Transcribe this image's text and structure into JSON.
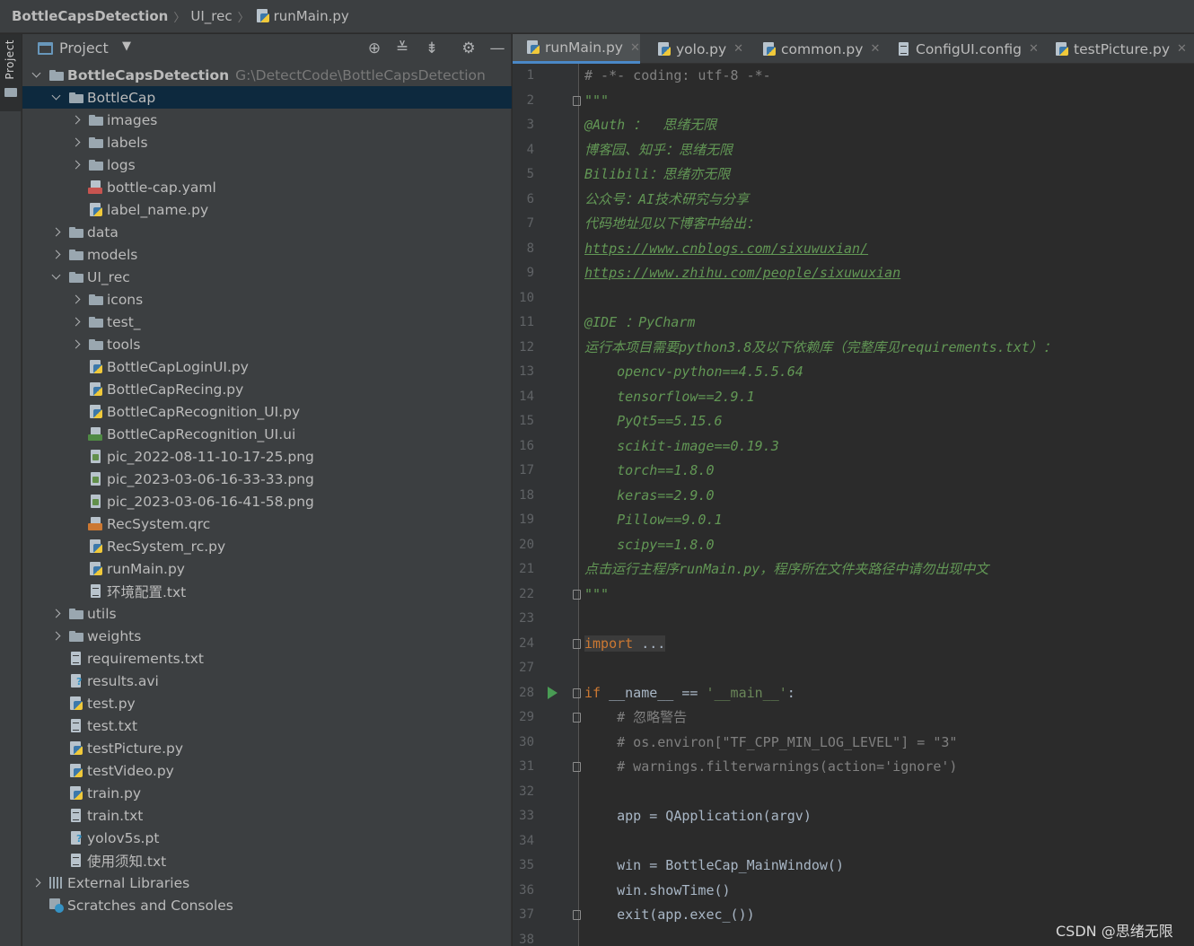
{
  "breadcrumb": [
    "BottleCapsDetection",
    "UI_rec",
    "runMain.py"
  ],
  "stripe": {
    "project_label": "Project"
  },
  "panel": {
    "title": "Project"
  },
  "tree": [
    {
      "depth": 0,
      "arrow": "down",
      "icon": "folder",
      "name": "BottleCapsDetection",
      "path": "G:\\DetectCode\\BottleCapsDetection",
      "bold": true
    },
    {
      "depth": 1,
      "arrow": "down",
      "icon": "folder",
      "name": "BottleCap",
      "selected": true
    },
    {
      "depth": 2,
      "arrow": "right",
      "icon": "folder",
      "name": "images"
    },
    {
      "depth": 2,
      "arrow": "right",
      "icon": "folder",
      "name": "labels"
    },
    {
      "depth": 2,
      "arrow": "right",
      "icon": "folder",
      "name": "logs"
    },
    {
      "depth": 2,
      "arrow": "none",
      "icon": "yamlfile",
      "name": "bottle-cap.yaml"
    },
    {
      "depth": 2,
      "arrow": "none",
      "icon": "pyfile",
      "name": "label_name.py"
    },
    {
      "depth": 1,
      "arrow": "right",
      "icon": "folder",
      "name": "data"
    },
    {
      "depth": 1,
      "arrow": "right",
      "icon": "folder",
      "name": "models"
    },
    {
      "depth": 1,
      "arrow": "down",
      "icon": "folder",
      "name": "UI_rec"
    },
    {
      "depth": 2,
      "arrow": "right",
      "icon": "folder",
      "name": "icons"
    },
    {
      "depth": 2,
      "arrow": "right",
      "icon": "folder",
      "name": "test_"
    },
    {
      "depth": 2,
      "arrow": "right",
      "icon": "folder",
      "name": "tools"
    },
    {
      "depth": 2,
      "arrow": "none",
      "icon": "pyfile",
      "name": "BottleCapLoginUI.py"
    },
    {
      "depth": 2,
      "arrow": "none",
      "icon": "pyfile",
      "name": "BottleCapRecing.py"
    },
    {
      "depth": 2,
      "arrow": "none",
      "icon": "pyfile",
      "name": "BottleCapRecognition_UI.py"
    },
    {
      "depth": 2,
      "arrow": "none",
      "icon": "uifile",
      "name": "BottleCapRecognition_UI.ui"
    },
    {
      "depth": 2,
      "arrow": "none",
      "icon": "pngfile",
      "name": "pic_2022-08-11-10-17-25.png"
    },
    {
      "depth": 2,
      "arrow": "none",
      "icon": "pngfile",
      "name": "pic_2023-03-06-16-33-33.png"
    },
    {
      "depth": 2,
      "arrow": "none",
      "icon": "pngfile",
      "name": "pic_2023-03-06-16-41-58.png"
    },
    {
      "depth": 2,
      "arrow": "none",
      "icon": "qrcfile",
      "name": "RecSystem.qrc"
    },
    {
      "depth": 2,
      "arrow": "none",
      "icon": "pyfile",
      "name": "RecSystem_rc.py"
    },
    {
      "depth": 2,
      "arrow": "none",
      "icon": "pyfile",
      "name": "runMain.py"
    },
    {
      "depth": 2,
      "arrow": "none",
      "icon": "txtfile",
      "name": "环境配置.txt"
    },
    {
      "depth": 1,
      "arrow": "right",
      "icon": "folder",
      "name": "utils"
    },
    {
      "depth": 1,
      "arrow": "right",
      "icon": "folder",
      "name": "weights"
    },
    {
      "depth": 1,
      "arrow": "none",
      "icon": "txtfile",
      "name": "requirements.txt"
    },
    {
      "depth": 1,
      "arrow": "none",
      "icon": "unknown",
      "name": "results.avi"
    },
    {
      "depth": 1,
      "arrow": "none",
      "icon": "pyfile",
      "name": "test.py"
    },
    {
      "depth": 1,
      "arrow": "none",
      "icon": "txtfile",
      "name": "test.txt"
    },
    {
      "depth": 1,
      "arrow": "none",
      "icon": "pyfile",
      "name": "testPicture.py"
    },
    {
      "depth": 1,
      "arrow": "none",
      "icon": "pyfile",
      "name": "testVideo.py"
    },
    {
      "depth": 1,
      "arrow": "none",
      "icon": "pyfile",
      "name": "train.py"
    },
    {
      "depth": 1,
      "arrow": "none",
      "icon": "txtfile",
      "name": "train.txt"
    },
    {
      "depth": 1,
      "arrow": "none",
      "icon": "unknown",
      "name": "yolov5s.pt"
    },
    {
      "depth": 1,
      "arrow": "none",
      "icon": "txtfile",
      "name": "使用须知.txt"
    },
    {
      "depth": 0,
      "arrow": "right",
      "icon": "libs",
      "name": "External Libraries"
    },
    {
      "depth": 0,
      "arrow": "none",
      "icon": "scratch",
      "name": "Scratches and Consoles"
    }
  ],
  "tabs": [
    {
      "label": "runMain.py",
      "icon": "pyfile",
      "active": true
    },
    {
      "label": "yolo.py",
      "icon": "pyfile"
    },
    {
      "label": "common.py",
      "icon": "pyfile"
    },
    {
      "label": "ConfigUI.config",
      "icon": "txtfile"
    },
    {
      "label": "testPicture.py",
      "icon": "pyfile"
    }
  ],
  "code": [
    {
      "n": "1",
      "parts": [
        [
          "c-gray",
          "# -*- coding: utf-8 -*-"
        ]
      ]
    },
    {
      "n": "2",
      "fold": true,
      "parts": [
        [
          "c-doc",
          "\"\"\""
        ]
      ]
    },
    {
      "n": "3",
      "parts": [
        [
          "c-doc",
          "@Auth ：  思绪无限"
        ]
      ]
    },
    {
      "n": "4",
      "parts": [
        [
          "c-doc",
          "博客园、知乎：思绪无限"
        ]
      ]
    },
    {
      "n": "5",
      "parts": [
        [
          "c-doc",
          "Bilibili：思绪亦无限"
        ]
      ]
    },
    {
      "n": "6",
      "parts": [
        [
          "c-doc",
          "公众号：AI技术研究与分享"
        ]
      ]
    },
    {
      "n": "7",
      "parts": [
        [
          "c-doc",
          "代码地址见以下博客中给出："
        ]
      ]
    },
    {
      "n": "8",
      "parts": [
        [
          "c-link",
          "https://www.cnblogs.com/sixuwuxian/"
        ]
      ]
    },
    {
      "n": "9",
      "parts": [
        [
          "c-link",
          "https://www.zhihu.com/people/sixuwuxian"
        ]
      ]
    },
    {
      "n": "10",
      "parts": []
    },
    {
      "n": "11",
      "parts": [
        [
          "c-doc",
          "@IDE ：PyCharm"
        ]
      ]
    },
    {
      "n": "12",
      "parts": [
        [
          "c-doc",
          "运行本项目需要python3.8及以下依赖库（完整库见requirements.txt）："
        ]
      ]
    },
    {
      "n": "13",
      "parts": [
        [
          "c-doc",
          "    opencv-python==4.5.5.64"
        ]
      ]
    },
    {
      "n": "14",
      "parts": [
        [
          "c-doc",
          "    tensorflow==2.9.1"
        ]
      ]
    },
    {
      "n": "15",
      "parts": [
        [
          "c-doc",
          "    PyQt5==5.15.6"
        ]
      ]
    },
    {
      "n": "16",
      "parts": [
        [
          "c-doc",
          "    scikit-image==0.19.3"
        ]
      ]
    },
    {
      "n": "17",
      "parts": [
        [
          "c-doc",
          "    torch==1.8.0"
        ]
      ]
    },
    {
      "n": "18",
      "parts": [
        [
          "c-doc",
          "    keras==2.9.0"
        ]
      ]
    },
    {
      "n": "19",
      "parts": [
        [
          "c-doc",
          "    Pillow==9.0.1"
        ]
      ]
    },
    {
      "n": "20",
      "parts": [
        [
          "c-doc",
          "    scipy==1.8.0"
        ]
      ]
    },
    {
      "n": "21",
      "parts": [
        [
          "c-doc",
          "点击运行主程序runMain.py，程序所在文件夹路径中请勿出现中文"
        ]
      ]
    },
    {
      "n": "22",
      "fold": true,
      "parts": [
        [
          "c-doc",
          "\"\"\""
        ]
      ]
    },
    {
      "n": "23",
      "parts": []
    },
    {
      "n": "24",
      "fold": true,
      "parts": [
        [
          "c-kw import-box",
          "import"
        ],
        [
          "c-plain import-box",
          " ..."
        ]
      ]
    },
    {
      "n": "27",
      "parts": []
    },
    {
      "n": "28",
      "fold": true,
      "run": true,
      "parts": [
        [
          "c-kw",
          "if "
        ],
        [
          "c-plain",
          "__name__ == "
        ],
        [
          "c-str",
          "'__main__'"
        ],
        [
          "c-plain",
          ":"
        ]
      ]
    },
    {
      "n": "29",
      "fold": true,
      "parts": [
        [
          "c-comment",
          "    # 忽略警告"
        ]
      ]
    },
    {
      "n": "30",
      "parts": [
        [
          "c-comment",
          "    # os.environ[\"TF_CPP_MIN_LOG_LEVEL\"] = \"3\""
        ]
      ]
    },
    {
      "n": "31",
      "fold": true,
      "parts": [
        [
          "c-comment",
          "    # warnings.filterwarnings(action='ignore')"
        ]
      ]
    },
    {
      "n": "32",
      "parts": []
    },
    {
      "n": "33",
      "parts": [
        [
          "c-plain",
          "    app = QApplication(argv)"
        ]
      ]
    },
    {
      "n": "34",
      "parts": []
    },
    {
      "n": "35",
      "parts": [
        [
          "c-plain",
          "    win = BottleCap_MainWindow()"
        ]
      ]
    },
    {
      "n": "36",
      "parts": [
        [
          "c-plain",
          "    win.showTime()"
        ]
      ]
    },
    {
      "n": "37",
      "fold": true,
      "parts": [
        [
          "c-plain",
          "    exit(app.exec_())"
        ]
      ]
    },
    {
      "n": "38",
      "parts": []
    }
  ],
  "watermark": "CSDN @思绪无限"
}
